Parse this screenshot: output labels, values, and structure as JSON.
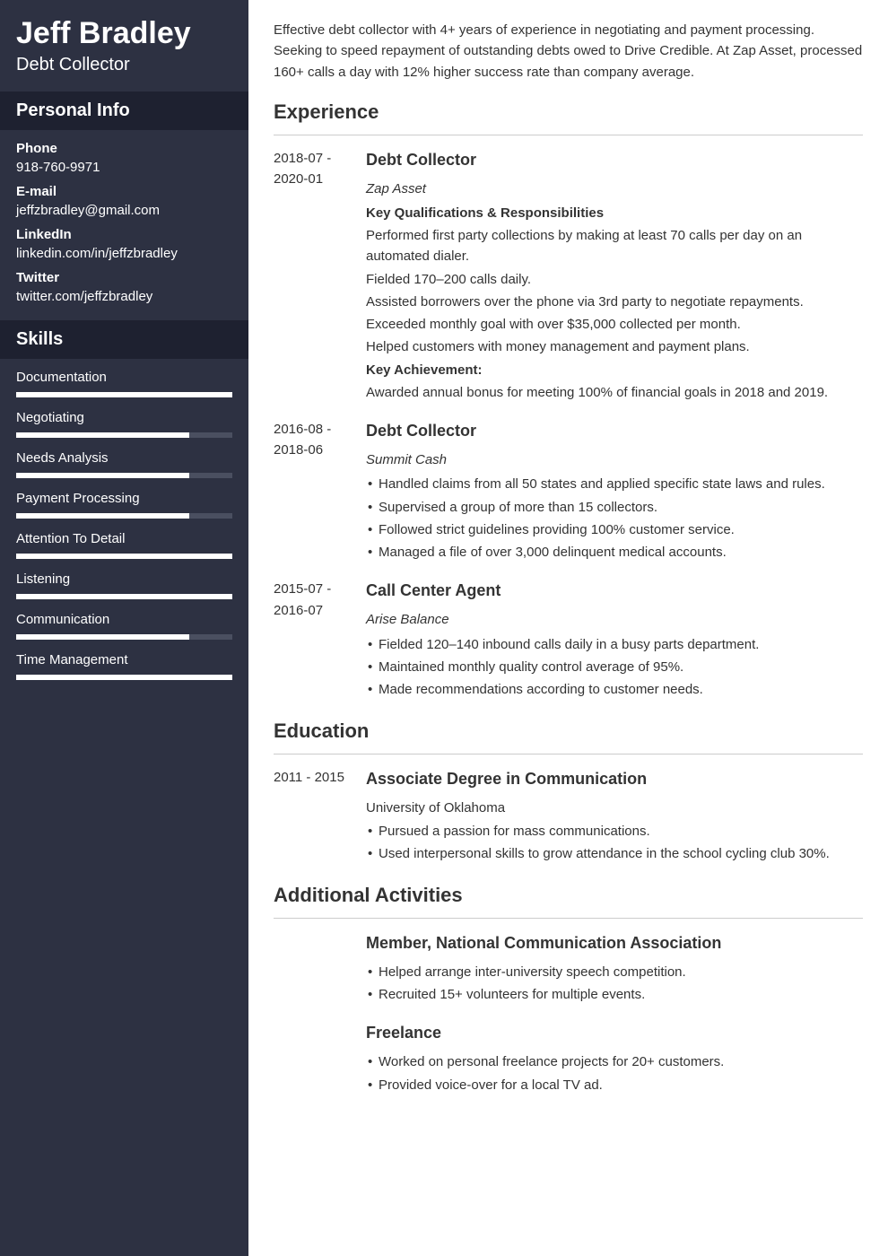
{
  "name": "Jeff Bradley",
  "title": "Debt Collector",
  "personalHead": "Personal Info",
  "skillsHead": "Skills",
  "info": [
    {
      "l": "Phone",
      "v": "918-760-9971"
    },
    {
      "l": "E-mail",
      "v": "jeffzbradley@gmail.com"
    },
    {
      "l": "LinkedIn",
      "v": "linkedin.com/in/jeffzbradley"
    },
    {
      "l": "Twitter",
      "v": "twitter.com/jeffzbradley"
    }
  ],
  "skills": [
    {
      "n": "Documentation",
      "p": 100
    },
    {
      "n": "Negotiating",
      "p": 80
    },
    {
      "n": "Needs Analysis",
      "p": 80
    },
    {
      "n": "Payment Processing",
      "p": 80
    },
    {
      "n": "Attention To Detail",
      "p": 100
    },
    {
      "n": "Listening",
      "p": 100
    },
    {
      "n": "Communication",
      "p": 80
    },
    {
      "n": "Time Management",
      "p": 100
    }
  ],
  "summary": "Effective debt collector with 4+ years of experience in negotiating and payment processing. Seeking to speed repayment of outstanding debts owed to Drive Credible. At Zap Asset, processed 160+ calls a day with 12% higher success rate than company average.",
  "expHead": "Experience",
  "eduHead": "Education",
  "addHead": "Additional Activities",
  "exp": [
    {
      "d": "2018-07 - 2020-01",
      "t": "Debt Collector",
      "o": "Zap Asset",
      "sub1": "Key Qualifications & Responsibilities",
      "lines": [
        "Performed first party collections by making at least 70 calls per day on an automated dialer.",
        "Fielded 170–200 calls daily.",
        "Assisted borrowers over the phone via 3rd party to negotiate repayments.",
        "Exceeded monthly goal with over $35,000 collected per month.",
        "Helped customers with money management and payment plans."
      ],
      "sub2": "Key Achievement:",
      "ach": "Awarded annual bonus for meeting 100% of financial goals in 2018 and 2019."
    },
    {
      "d": "2016-08 - 2018-06",
      "t": "Debt Collector",
      "o": "Summit Cash",
      "bl": [
        "Handled claims from all 50 states and applied specific state laws and rules.",
        "Supervised a group of more than 15 collectors.",
        "Followed strict guidelines providing 100% customer service.",
        "Managed a file of over 3,000 delinquent medical accounts."
      ]
    },
    {
      "d": "2015-07 - 2016-07",
      "t": "Call Center Agent",
      "o": "Arise Balance",
      "bl": [
        "Fielded 120–140 inbound calls daily in a busy parts department.",
        "Maintained monthly quality control average of 95%.",
        "Made recommendations according to customer needs."
      ]
    }
  ],
  "edu": {
    "d": "2011 - 2015",
    "t": "Associate Degree in Communication",
    "o": "University of Oklahoma",
    "bl": [
      "Pursued a passion for mass communications.",
      "Used interpersonal skills to grow attendance in the school cycling club 30%."
    ]
  },
  "act": [
    {
      "t": "Member, National Communication Association",
      "bl": [
        "Helped arrange inter-university speech competition.",
        "Recruited 15+ volunteers for multiple events."
      ]
    },
    {
      "t": "Freelance",
      "bl": [
        "Worked on personal freelance projects for 20+ customers.",
        "Provided voice-over for a local TV ad."
      ]
    }
  ]
}
